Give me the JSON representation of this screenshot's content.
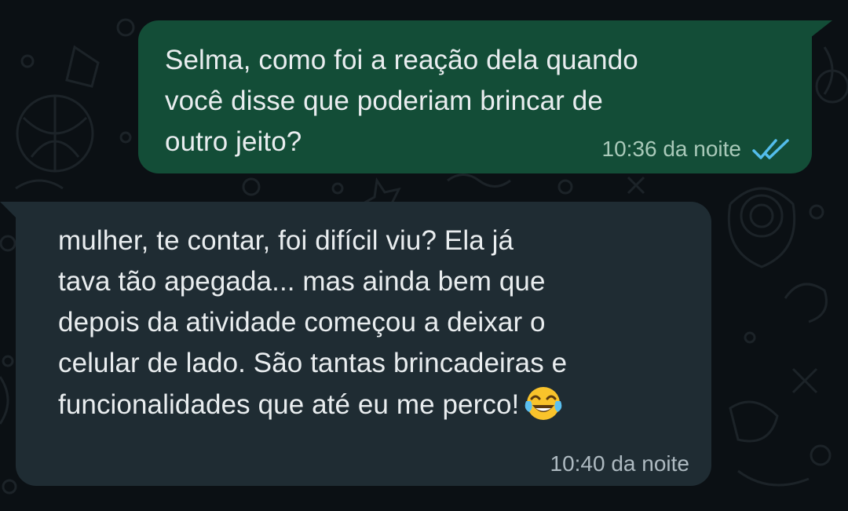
{
  "chat": {
    "messages": [
      {
        "direction": "outgoing",
        "text": "Selma, como foi a reação dela quando\nvocê disse que poderiam brincar de\noutro jeito?",
        "time": "10:36 da noite",
        "status_icon": "double-check-read-icon",
        "status_color": "#53bdeb"
      },
      {
        "direction": "incoming",
        "text": "mulher, te contar, foi difícil viu? Ela já\ntava tão apegada... mas ainda bem que\ndepois da atividade começou a deixar o\ncelular de lado. São tantas brincadeiras e\nfuncionalidades que até eu me perco!",
        "emoji": "😂",
        "time": "10:40 da noite"
      }
    ]
  },
  "colors": {
    "background": "#0b1014",
    "outgoing_bubble": "#134d37",
    "incoming_bubble": "#1f2c33",
    "text": "#e9edef",
    "timestamp": "#aebac1"
  }
}
